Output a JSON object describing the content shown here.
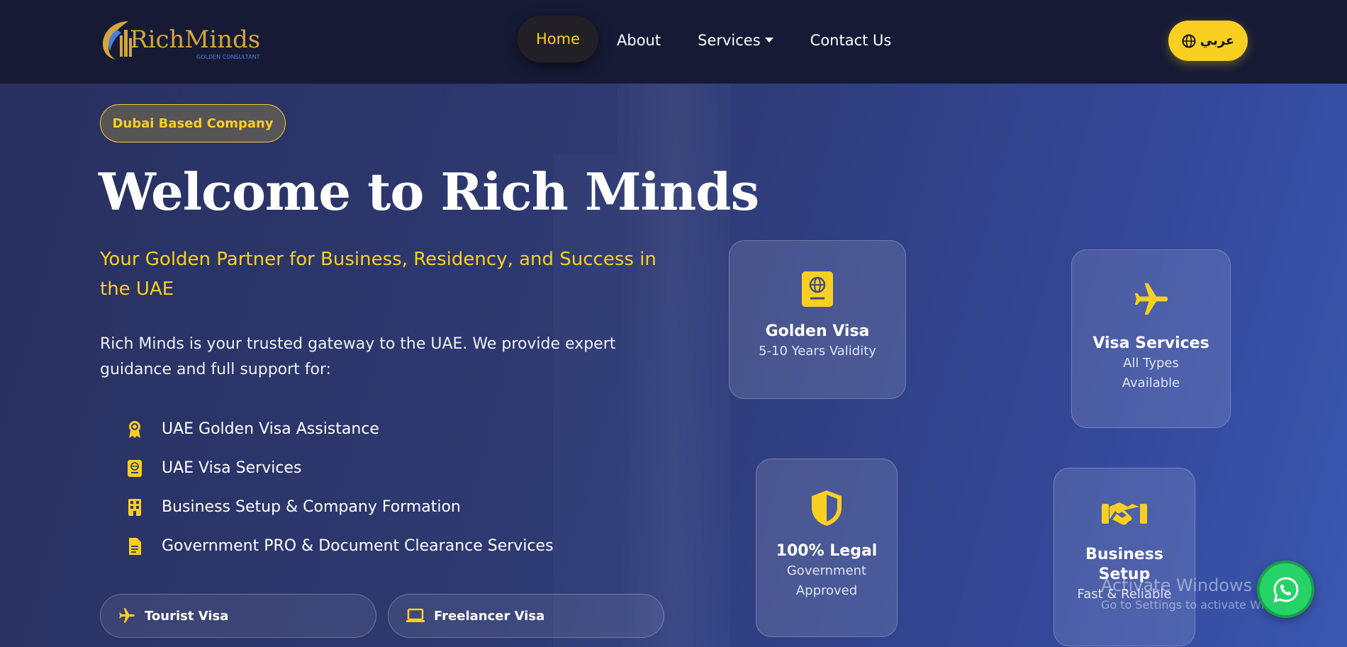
{
  "brand": {
    "logo_main": "RichMinds",
    "logo_sub": "GOLDEN CONSULTANT",
    "accent_color": "#f9cf22"
  },
  "nav": {
    "items": [
      {
        "label": "Home",
        "active": true
      },
      {
        "label": "About"
      },
      {
        "label": "Services",
        "dropdown": true
      },
      {
        "label": "Contact Us"
      }
    ],
    "lang_label": "عربي",
    "lang_icon": "globe-icon"
  },
  "hero": {
    "badge": "Dubai Based Company",
    "title": "Welcome to Rich Minds",
    "subtitle": "Your Golden Partner for Business, Residency, and Success in the UAE",
    "intro": "Rich Minds is your trusted gateway to the UAE. We provide expert guidance and full support for:",
    "features": [
      {
        "label": "UAE Golden Visa Assistance",
        "icon": "award-icon"
      },
      {
        "label": "UAE Visa Services",
        "icon": "passport-icon"
      },
      {
        "label": "Business Setup & Company Formation",
        "icon": "building-icon"
      },
      {
        "label": "Government PRO & Document Clearance Services",
        "icon": "document-icon"
      }
    ],
    "pills": [
      {
        "label": "Tourist Visa",
        "icon": "plane-icon"
      },
      {
        "label": "Freelancer Visa",
        "icon": "laptop-icon"
      }
    ]
  },
  "cards": [
    {
      "title": "Golden Visa",
      "subtitle": "5-10 Years Validity",
      "icon": "passport-icon"
    },
    {
      "title": "Visa Services",
      "subtitle": "All Types Available",
      "icon": "plane-icon"
    },
    {
      "title": "100% Legal",
      "subtitle": "Government Approved",
      "icon": "shield-icon"
    },
    {
      "title": "Business Setup",
      "subtitle": "Fast & Reliable",
      "icon": "handshake-icon"
    }
  ],
  "watermark": {
    "line1": "Activate Windows",
    "line2": "Go to Settings to activate Windows."
  },
  "whatsapp_icon": "whatsapp-icon"
}
